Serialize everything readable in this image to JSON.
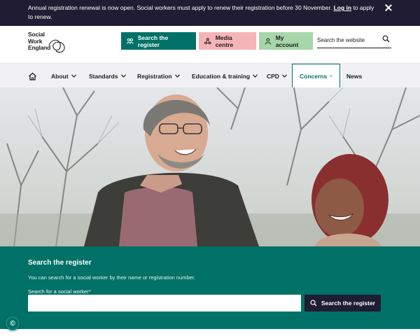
{
  "banner": {
    "text_before": "Annual registration renewal is now open. Social workers must apply to renew their registration before 30 November. ",
    "link": "Log in",
    "text_after": " to apply to renew."
  },
  "logo": {
    "line1": "Social",
    "line2": "Work",
    "line3": "England"
  },
  "header": {
    "register_label": "Search the register",
    "media_label": "Media centre",
    "account_label": "My account",
    "search_placeholder": "Search the website"
  },
  "nav": {
    "items": [
      {
        "label": "About"
      },
      {
        "label": "Standards"
      },
      {
        "label": "Registration"
      },
      {
        "label": "Education & training"
      },
      {
        "label": "CPD"
      },
      {
        "label": "Concerns"
      },
      {
        "label": "News"
      }
    ]
  },
  "search_panel": {
    "title": "Search the register",
    "description": "You can search for a social worker by their name or registration number.",
    "field_label": "Search for a social worker*",
    "button_label": "Search the register"
  },
  "colors": {
    "teal": "#007167",
    "navy": "#1f1c33",
    "pink": "#f5b4b8",
    "green": "#a6d6a9"
  }
}
